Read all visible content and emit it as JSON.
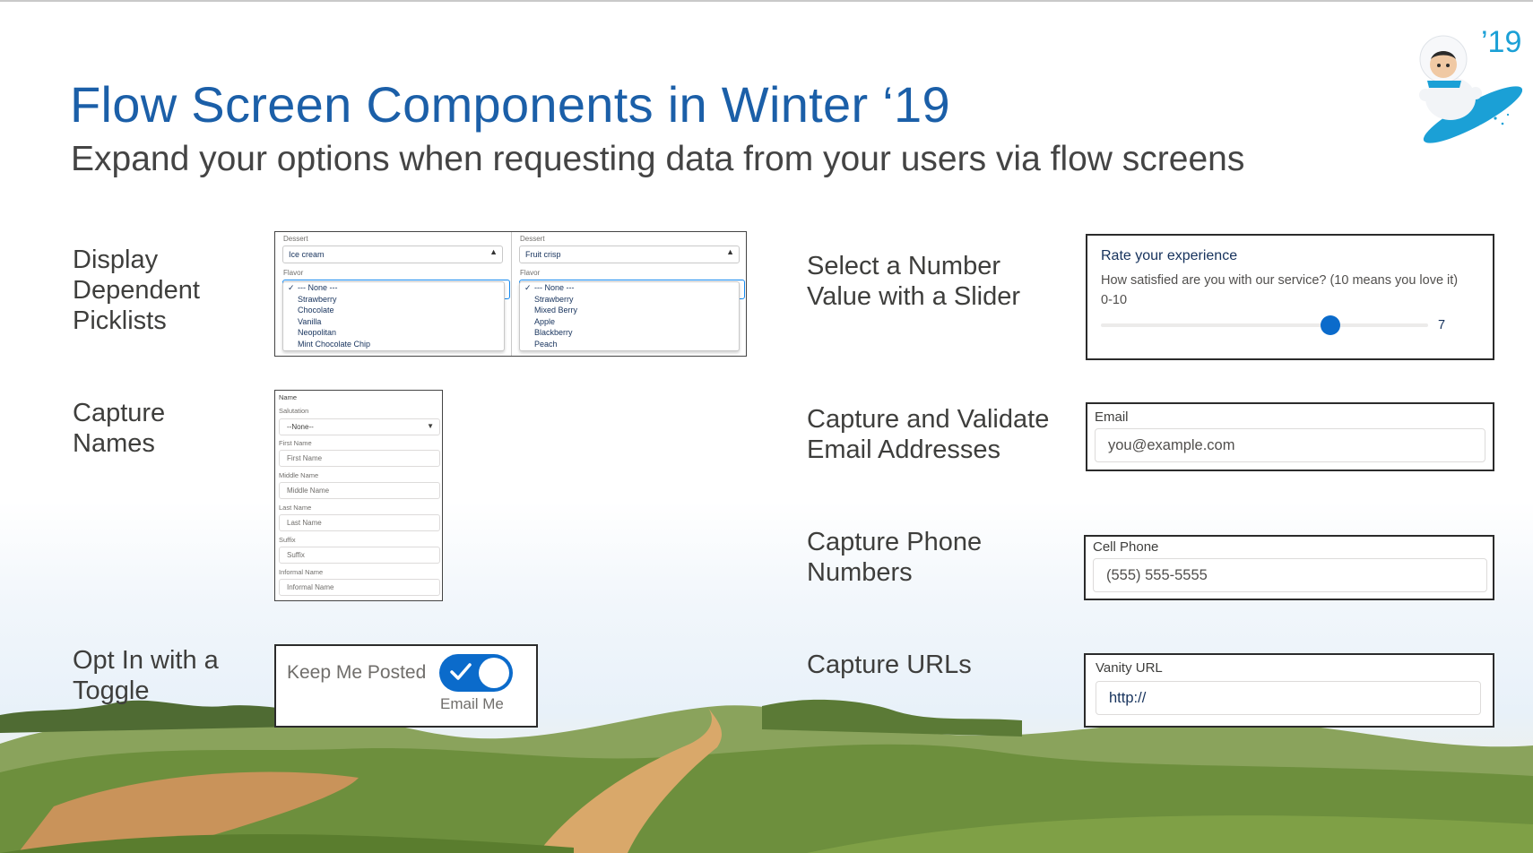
{
  "slide": {
    "title": "Flow Screen Components in Winter ‘19",
    "subtitle": "Expand your options when requesting data from your users via flow screens",
    "badge": "’19"
  },
  "features": {
    "picklists": "Display\nDependent\nPicklists",
    "names": "Capture\nNames",
    "toggle": "Opt In with a\nToggle",
    "slider": "Select a Number\nValue with a Slider",
    "email": "Capture and Validate\nEmail Addresses",
    "phone": "Capture Phone\nNumbers",
    "urls": "Capture URLs"
  },
  "picklists": {
    "left": {
      "dessert_label": "Dessert",
      "dessert_value": "Ice cream",
      "flavor_label": "Flavor",
      "options": [
        "--- None ---",
        "Strawberry",
        "Chocolate",
        "Vanilla",
        "Neopolitan",
        "Mint Chocolate Chip"
      ]
    },
    "right": {
      "dessert_label": "Dessert",
      "dessert_value": "Fruit crisp",
      "flavor_label": "Flavor",
      "options": [
        "--- None ---",
        "Strawberry",
        "Mixed Berry",
        "Apple",
        "Blackberry",
        "Peach"
      ]
    }
  },
  "name_form": {
    "header": "Name",
    "salutation_label": "Salutation",
    "salutation_value": "--None--",
    "first_label": "First Name",
    "first_placeholder": "First Name",
    "middle_label": "Middle Name",
    "middle_placeholder": "Middle Name",
    "last_label": "Last Name",
    "last_placeholder": "Last Name",
    "suffix_label": "Suffix",
    "suffix_placeholder": "Suffix",
    "informal_label": "Informal Name",
    "informal_placeholder": "Informal Name"
  },
  "toggle": {
    "label": "Keep Me Posted",
    "caption": "Email Me",
    "checked": true,
    "accent": "#0b6bcb"
  },
  "slider": {
    "title": "Rate your experience",
    "question": "How satisfied are you with our service? (10 means you love it)",
    "range": "0-10",
    "min": 0,
    "max": 10,
    "value": 7,
    "value_label": "7"
  },
  "email": {
    "label": "Email",
    "placeholder": "you@example.com"
  },
  "phone": {
    "label": "Cell Phone",
    "placeholder": "(555) 555-5555"
  },
  "url": {
    "label": "Vanity URL",
    "value": "http://"
  },
  "colors": {
    "title": "#1b5fa8",
    "badge": "#1ba0d6",
    "accent": "#0b6bcb"
  }
}
